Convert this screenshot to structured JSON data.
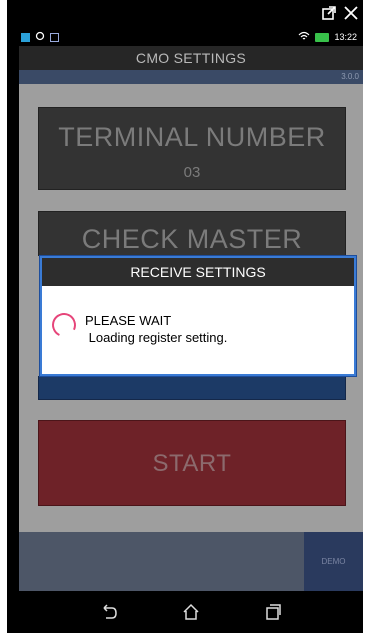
{
  "status_bar": {
    "time": "13:22",
    "icons": [
      "notification-square-icon",
      "eye-icon",
      "image-icon",
      "wifi-icon",
      "battery-icon"
    ]
  },
  "app": {
    "title": "CMO SETTINGS",
    "version": "3.0.0",
    "terminal_label": "TERMINAL NUMBER",
    "terminal_value": "03",
    "check_label": "CHECK MASTER",
    "start_label": "START",
    "demo_label": "DEMO"
  },
  "dialog": {
    "title": "RECEIVE SETTINGS",
    "line1": "PLEASE WAIT",
    "line2": " Loading register setting."
  },
  "colors": {
    "dialog_border": "#3a7bd5",
    "start_button": "#6e2228",
    "spinner": "#e6457a"
  }
}
